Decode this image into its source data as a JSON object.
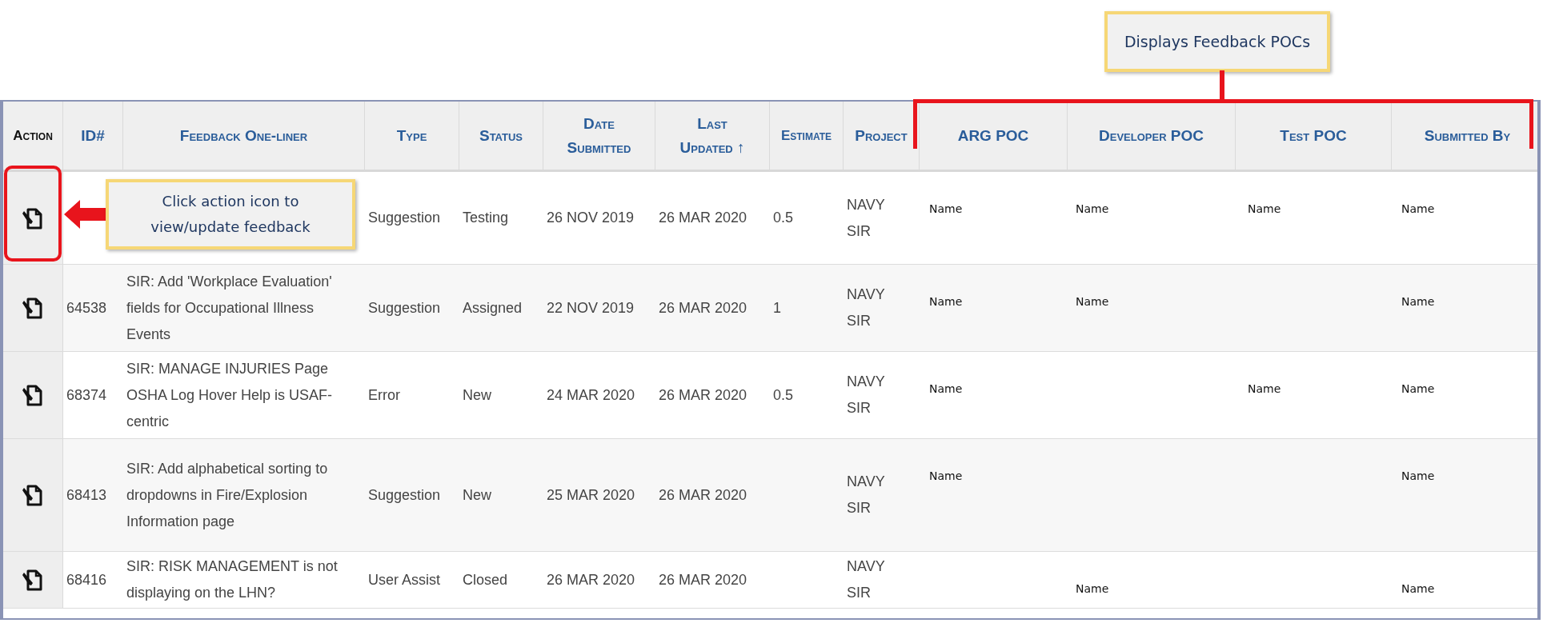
{
  "annotations": [
    {
      "kind": "header_callout",
      "text": "Displays Feedback POCs"
    },
    {
      "kind": "row_callout",
      "text": "Click action icon to view/update feedback"
    }
  ],
  "table": {
    "columns": [
      "Action",
      "ID#",
      "Feedback One-liner",
      "Type",
      "Status",
      "Date Submitted",
      "Last Updated ↑",
      "Estimate",
      "Project",
      "ARG POC",
      "Developer POC",
      "Test POC",
      "Submitted By"
    ],
    "rows": [
      {
        "id": "",
        "one_liner": "",
        "type": "Suggestion",
        "status": "Testing",
        "date_submitted": "26 NOV 2019",
        "last_updated": "26 MAR 2020",
        "estimate": "0.5",
        "project": "NAVY SIR",
        "arg_poc": "Name",
        "developer_poc": "Name",
        "test_poc": "Name",
        "submitted_by": "Name"
      },
      {
        "id": "64538",
        "one_liner": "SIR: Add 'Workplace Evaluation' fields for Occupational Illness Events",
        "type": "Suggestion",
        "status": "Assigned",
        "date_submitted": "22 NOV 2019",
        "last_updated": "26 MAR 2020",
        "estimate": "1",
        "project": "NAVY SIR",
        "arg_poc": "Name",
        "developer_poc": "Name",
        "test_poc": "",
        "submitted_by": "Name"
      },
      {
        "id": "68374",
        "one_liner": "SIR: MANAGE INJURIES Page OSHA Log Hover Help is USAF-centric",
        "type": "Error",
        "status": "New",
        "date_submitted": "24 MAR 2020",
        "last_updated": "26 MAR 2020",
        "estimate": "0.5",
        "project": "NAVY SIR",
        "arg_poc": "Name",
        "developer_poc": "",
        "test_poc": "Name",
        "submitted_by": "Name"
      },
      {
        "id": "68413",
        "one_liner": "SIR: Add alphabetical sorting to dropdowns in Fire/Explosion Information page",
        "type": "Suggestion",
        "status": "New",
        "date_submitted": "25 MAR 2020",
        "last_updated": "26 MAR 2020",
        "estimate": "",
        "project": "NAVY SIR",
        "arg_poc": "Name",
        "developer_poc": "",
        "test_poc": "",
        "submitted_by": "Name"
      },
      {
        "id": "68416",
        "one_liner": "SIR: RISK MANAGEMENT is not displaying on the LHN?",
        "type": "User Assist",
        "status": "Closed",
        "date_submitted": "26 MAR 2020",
        "last_updated": "26 MAR 2020",
        "estimate": "",
        "project": "NAVY SIR",
        "arg_poc": "",
        "developer_poc": "Name",
        "test_poc": "",
        "submitted_by": "Name"
      }
    ]
  }
}
